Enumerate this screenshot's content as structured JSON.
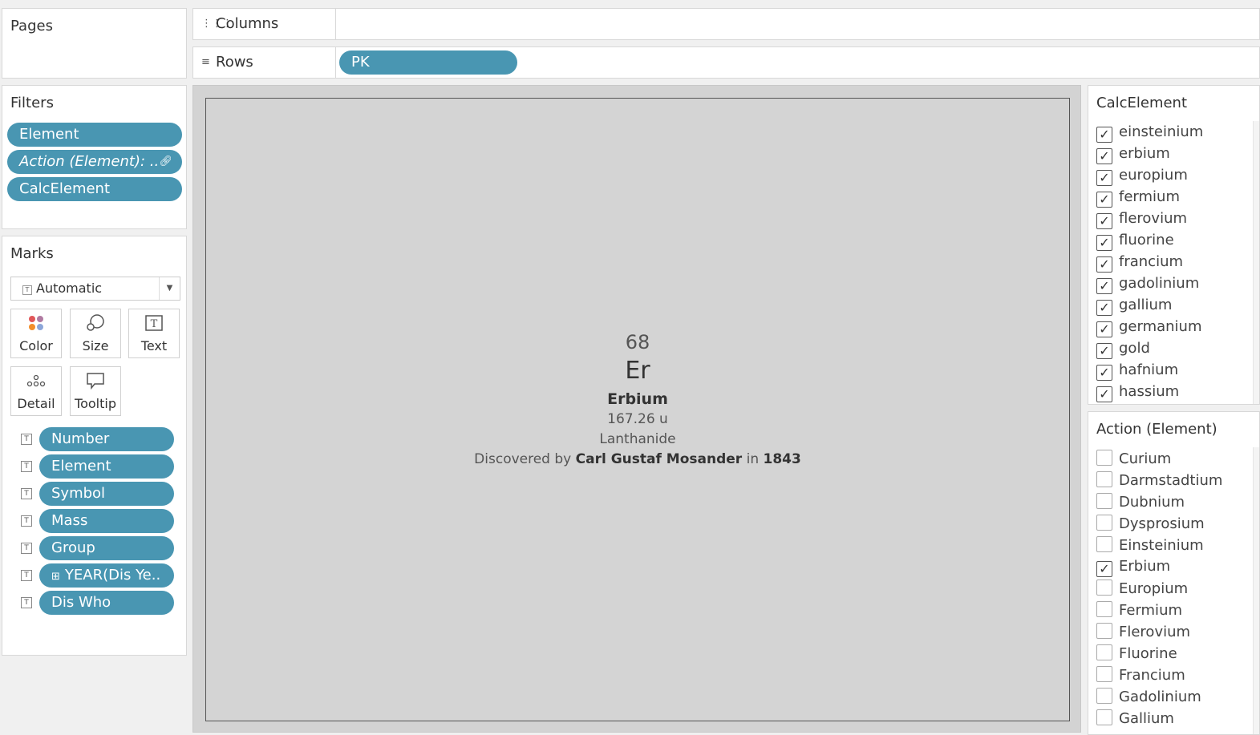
{
  "pages": {
    "title": "Pages"
  },
  "filters": {
    "title": "Filters",
    "pills": [
      "Element",
      "Action (Element): ..",
      "CalcElement"
    ]
  },
  "marks": {
    "title": "Marks",
    "type": "Automatic",
    "buttons": {
      "color": "Color",
      "size": "Size",
      "text": "Text",
      "detail": "Detail",
      "tooltip": "Tooltip"
    },
    "fields": [
      "Number",
      "Element",
      "Symbol",
      "Mass",
      "Group",
      "YEAR(Dis Ye..",
      "Dis Who"
    ]
  },
  "shelves": {
    "columns": {
      "label": "Columns",
      "pills": []
    },
    "rows": {
      "label": "Rows",
      "pills": [
        "PK"
      ]
    }
  },
  "view": {
    "number": "68",
    "symbol": "Er",
    "name": "Erbium",
    "mass": "167.26 u",
    "group": "Lanthanide",
    "discovered_prefix": "Discovered by ",
    "discoverer": "Carl Gustaf Mosander",
    "discovered_mid": " in ",
    "year": "1843"
  },
  "calc_element": {
    "title": "CalcElement",
    "items": [
      {
        "label": "einsteinium",
        "checked": true
      },
      {
        "label": "erbium",
        "checked": true
      },
      {
        "label": "europium",
        "checked": true
      },
      {
        "label": "fermium",
        "checked": true
      },
      {
        "label": "flerovium",
        "checked": true
      },
      {
        "label": "fluorine",
        "checked": true
      },
      {
        "label": "francium",
        "checked": true
      },
      {
        "label": "gadolinium",
        "checked": true
      },
      {
        "label": "gallium",
        "checked": true
      },
      {
        "label": "germanium",
        "checked": true
      },
      {
        "label": "gold",
        "checked": true
      },
      {
        "label": "hafnium",
        "checked": true
      },
      {
        "label": "hassium",
        "checked": true
      }
    ]
  },
  "action_element": {
    "title": "Action (Element)",
    "items": [
      {
        "label": "Curium",
        "checked": false
      },
      {
        "label": "Darmstadtium",
        "checked": false
      },
      {
        "label": "Dubnium",
        "checked": false
      },
      {
        "label": "Dysprosium",
        "checked": false
      },
      {
        "label": "Einsteinium",
        "checked": false
      },
      {
        "label": "Erbium",
        "checked": true
      },
      {
        "label": "Europium",
        "checked": false
      },
      {
        "label": "Fermium",
        "checked": false
      },
      {
        "label": "Flerovium",
        "checked": false
      },
      {
        "label": "Fluorine",
        "checked": false
      },
      {
        "label": "Francium",
        "checked": false
      },
      {
        "label": "Gadolinium",
        "checked": false
      },
      {
        "label": "Gallium",
        "checked": false
      }
    ]
  },
  "colors": {
    "pill": "#4996b2",
    "view_bg": "#d4d4d4"
  }
}
